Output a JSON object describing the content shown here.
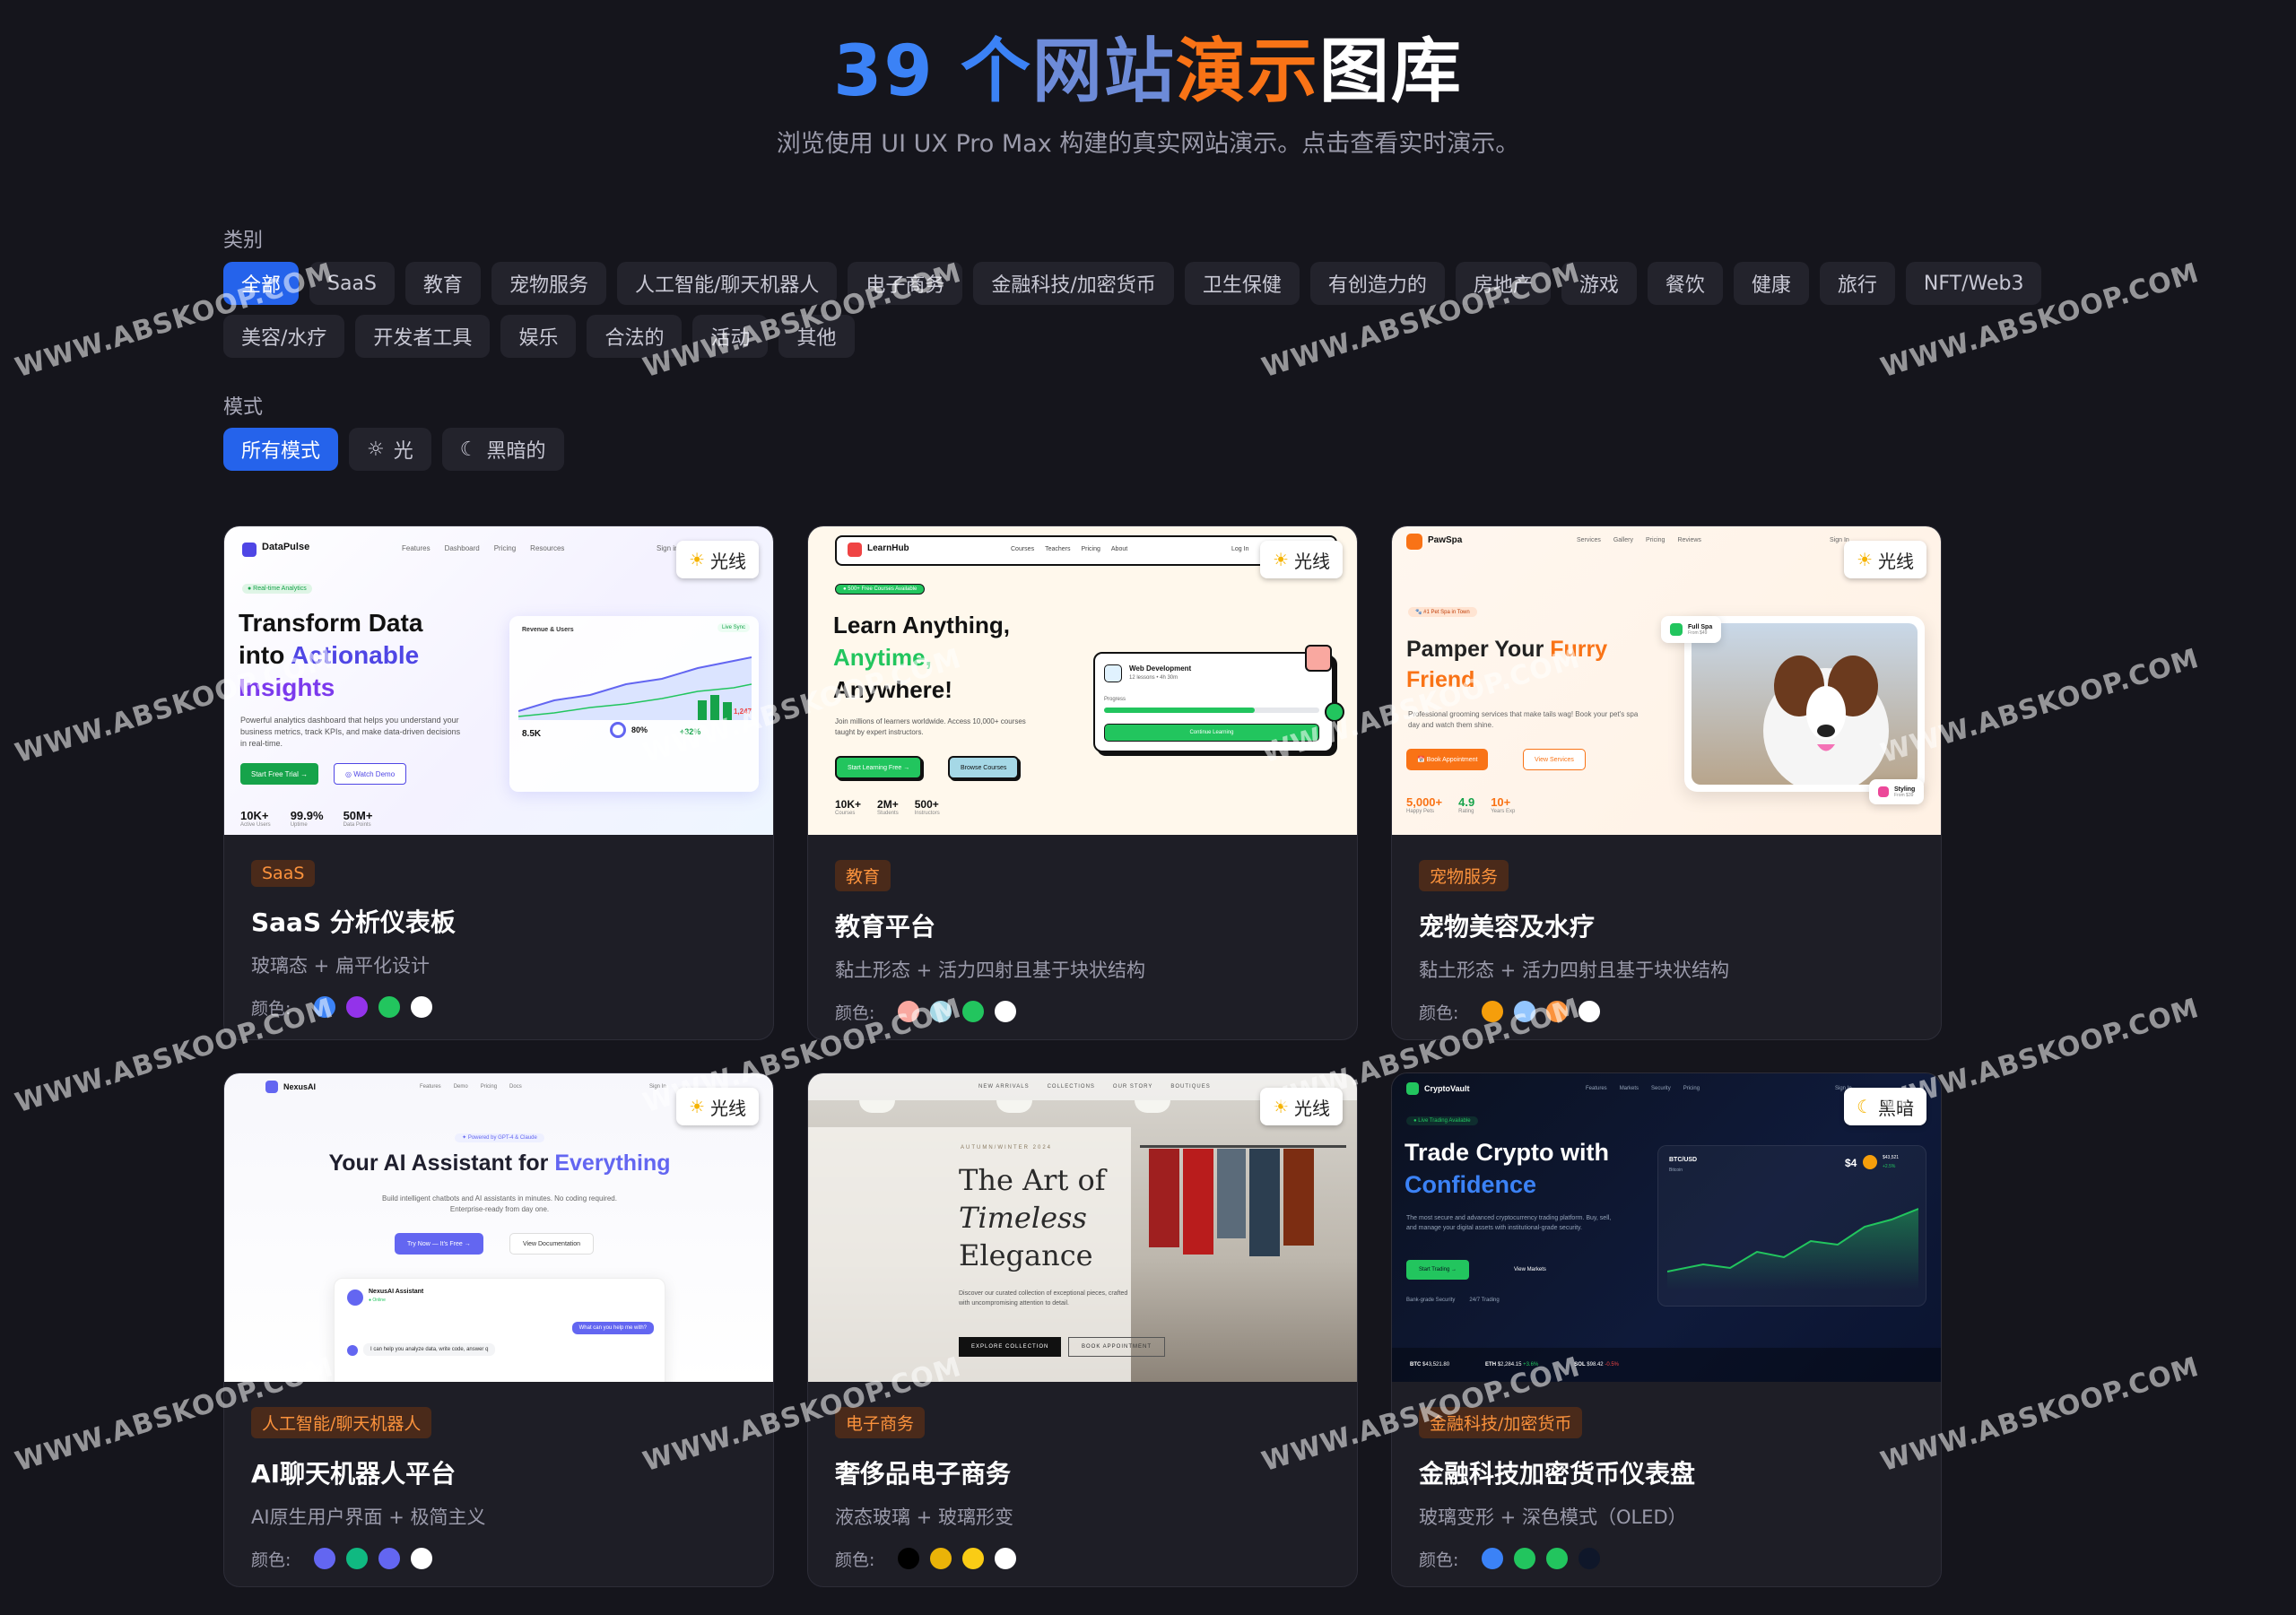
{
  "hero": {
    "title_part1": "39 个",
    "title_part2": "网站",
    "title_part3": "演示",
    "title_part4": "图库",
    "subtitle": "浏览使用 UI UX Pro Max 构建的真实网站演示。点击查看实时演示。"
  },
  "filters": {
    "category_label": "类别",
    "categories": [
      "全部",
      "SaaS",
      "教育",
      "宠物服务",
      "人工智能/聊天机器人",
      "电子商务",
      "金融科技/加密货币",
      "卫生保健",
      "有创造力的",
      "房地产",
      "游戏",
      "餐饮",
      "健康",
      "旅行",
      "NFT/Web3",
      "美容/水疗",
      "开发者工具",
      "娱乐",
      "合法的",
      "活动",
      "其他"
    ],
    "mode_label": "模式",
    "modes": [
      "所有模式",
      "光",
      "黑暗的"
    ]
  },
  "cards": [
    {
      "badge": "光线",
      "tag": "SaaS",
      "title": "SaaS 分析仪表板",
      "desc": "玻璃态 + 扁平化设计",
      "colors_label": "颜色:",
      "colors": [
        "#3b82f6",
        "#9333ea",
        "#22c55e",
        "#ffffff"
      ],
      "preview": {
        "brand": "DataPulse",
        "nav": [
          "Features",
          "Dashboard",
          "Pricing",
          "Resources"
        ],
        "signin": "Sign in",
        "pill": "● Real-time Analytics",
        "h1a": "Transform Data",
        "h1b": "into ",
        "h1c": "Actionable",
        "h1d": "Insights",
        "p": "Powerful analytics dashboard that helps you understand your business metrics, track KPIs, and make data-driven decisions in real-time.",
        "cta1": "Start Free Trial →",
        "cta2": "◎ Watch Demo",
        "s1": "10K+",
        "s1l": "Active Users",
        "s2": "99.9%",
        "s2l": "Uptime",
        "s3": "50M+",
        "s3l": "Data Points",
        "chart_title": "Revenue & Users",
        "live": "Live Sync",
        "k1": "8.5K",
        "k2": "80%",
        "k3": "+32%",
        "side": "1,247"
      }
    },
    {
      "badge": "光线",
      "tag": "教育",
      "title": "教育平台",
      "desc": "黏土形态 + 活力四射且基于块状结构",
      "colors_label": "颜色:",
      "colors": [
        "#f9a8a0",
        "#a5d8e6",
        "#22c55e",
        "#ffffff"
      ],
      "preview": {
        "brand": "LearnHub",
        "nav": [
          "Courses",
          "Teachers",
          "Pricing",
          "About"
        ],
        "signin": "Log In",
        "pill": "● 500+ Free Courses Available",
        "h1a": "Learn Anything,",
        "h1b": "Anytime,",
        "h1c": "Anywhere!",
        "p": "Join millions of learners worldwide. Access 10,000+ courses taught by expert instructors.",
        "cta1": "Start Learning Free →",
        "cta2": "Browse Courses",
        "s1": "10K+",
        "s1l": "Courses",
        "s2": "2M+",
        "s2l": "Students",
        "s3": "500+",
        "s3l": "Instructors",
        "course": "Web Development",
        "course_sub": "12 lessons • 4h 30m",
        "progress": "Progress",
        "cont": "Continue Learning"
      }
    },
    {
      "badge": "光线",
      "tag": "宠物服务",
      "title": "宠物美容及水疗",
      "desc": "黏土形态 + 活力四射且基于块状结构",
      "colors_label": "颜色:",
      "colors": [
        "#f59e0b",
        "#93c5fd",
        "#fb923c",
        "#ffffff"
      ],
      "preview": {
        "brand": "PawSpa",
        "nav": [
          "Services",
          "Gallery",
          "Pricing",
          "Reviews"
        ],
        "signin": "Sign In",
        "pill": "🐾 #1 Pet Spa in Town",
        "h1a": "Pamper Your ",
        "h1b": "Furry",
        "h1c": "Friend",
        "p": "Professional grooming services that make tails wag! Book your pet's spa day and watch them shine.",
        "cta1": "📅 Book Appointment",
        "cta2": "View Services",
        "s1": "5,000+",
        "s1l": "Happy Pets",
        "s2": "4.9",
        "s2l": "Rating",
        "s3": "10+",
        "s3l": "Years Exp",
        "float1": "Full Spa",
        "float1s": "From $49",
        "float2": "Styling",
        "float2s": "From $39"
      }
    },
    {
      "badge": "光线",
      "tag": "人工智能/聊天机器人",
      "title": "AI聊天机器人平台",
      "desc": "AI原生用户界面 + 极简主义",
      "colors_label": "颜色:",
      "colors": [
        "#6366f1",
        "#10b981",
        "#6366f1",
        "#ffffff"
      ],
      "preview": {
        "brand": "NexusAI",
        "nav": [
          "Features",
          "Demo",
          "Pricing",
          "Docs"
        ],
        "signin": "Sign In",
        "pill": "✦ Powered by GPT-4 & Claude",
        "h1a": "Your AI Assistant for ",
        "h1b": "Everything",
        "p": "Build intelligent chatbots and AI assistants in minutes. No coding required. Enterprise-ready from day one.",
        "cta1": "Try Now — It's Free →",
        "cta2": "View Documentation",
        "chat_name": "NexusAI Assistant",
        "chat_status": "● Online",
        "msg_user": "What can you help me with?",
        "msg_bot": "I can help you analyze data, write code, answer q"
      }
    },
    {
      "badge": "光线",
      "tag": "电子商务",
      "title": "奢侈品电子商务",
      "desc": "液态玻璃 + 玻璃形变",
      "colors_label": "颜色:",
      "colors": [
        "#000000",
        "#eab308",
        "#facc15",
        "#ffffff"
      ],
      "preview": {
        "nav": [
          "NEW ARRIVALS",
          "COLLECTIONS",
          "OUR STORY",
          "BOUTIQUES"
        ],
        "eyebrow": "AUTUMN/WINTER 2024",
        "h1a": "The Art of",
        "h1b": "Timeless",
        "h1c": "Elegance",
        "p": "Discover our curated collection of exceptional pieces, crafted with uncompromising attention to detail.",
        "cta1": "EXPLORE COLLECTION",
        "cta2": "BOOK APPOINTMENT"
      }
    },
    {
      "badge": "黑暗",
      "tag": "金融科技/加密货币",
      "title": "金融科技加密货币仪表盘",
      "desc": "玻璃变形 + 深色模式（OLED）",
      "colors_label": "颜色:",
      "colors": [
        "#3b82f6",
        "#22c55e",
        "#22c55e",
        "#0f172a"
      ],
      "preview": {
        "brand": "CryptoVault",
        "nav": [
          "Features",
          "Markets",
          "Security",
          "Pricing"
        ],
        "signin": "Sign In",
        "pill": "● Live Trading Available",
        "h1a": "Trade Crypto with",
        "h1b": "Confidence",
        "p": "The most secure and advanced cryptocurrency trading platform. Buy, sell, and manage your digital assets with institutional-grade security.",
        "cta1": "Start Trading →",
        "cta2": "View Markets",
        "f1": "Bank-grade Security",
        "f2": "24/7 Trading",
        "pair": "BTC/USD",
        "pair_sub": "Bitcoin",
        "price": "$4",
        "price2": "$43,521",
        "chg": "+2.5%",
        "t1": "BTC",
        "t1v": "$43,521.80",
        "t2": "ETH",
        "t2v": "$2,284.15",
        "t2c": "+3.6%",
        "t3": "SOL",
        "t3v": "$98.42",
        "t3c": "-0.5%"
      }
    }
  ],
  "watermark": "WWW.ABSKOOP.COM"
}
